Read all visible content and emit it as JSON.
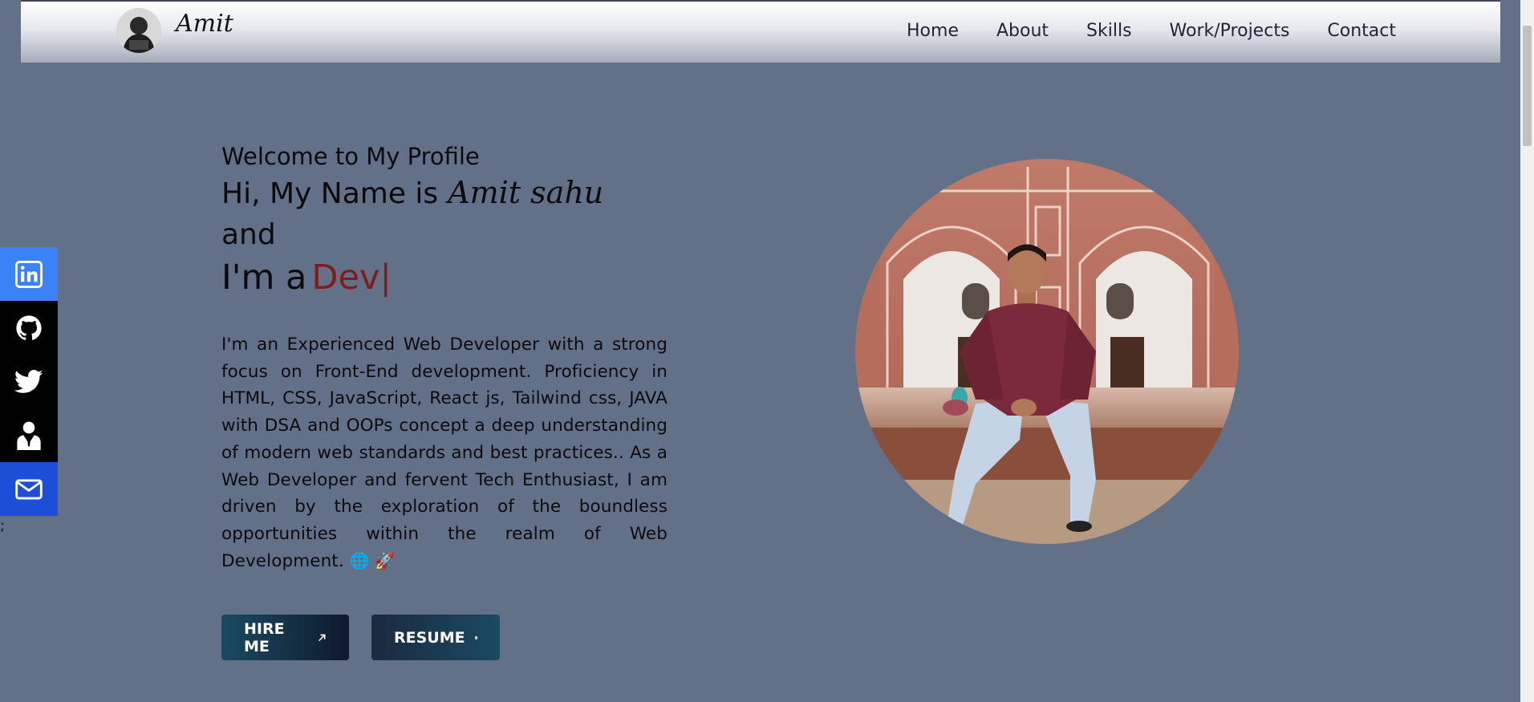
{
  "header": {
    "brand_name": "Amit",
    "nav": [
      "Home",
      "About",
      "Skills",
      "Work/Projects",
      "Contact"
    ]
  },
  "social": {
    "items": [
      {
        "name": "linkedin-icon",
        "color": "#3b82f6"
      },
      {
        "name": "github-icon",
        "color": "#000000"
      },
      {
        "name": "twitter-icon",
        "color": "#000000"
      },
      {
        "name": "user-tie-icon",
        "color": "#000000"
      },
      {
        "name": "mail-icon",
        "color": "#1d4ed8"
      }
    ],
    "stray_text": ";"
  },
  "hero": {
    "welcome": "Welcome to My Profile",
    "hi_prefix": "Hi, My Name is",
    "name_script": "Amit sahu",
    "and": "and",
    "im_prefix": "I'm a",
    "role": "Dev",
    "cursor": "|",
    "bio": "I'm an Experienced Web Developer with a strong focus on Front-End development. Proficiency in HTML, CSS, JavaScript, React js, Tailwind css, JAVA with DSA and OOPs concept a deep understanding of modern web standards and best practices.. As a Web Developer and fervent Tech Enthusiast, I am driven by the exploration of the boundless opportunities within the realm of Web Development.",
    "bio_emoji": "🌐 🚀",
    "buttons": {
      "hire": "HIRE ME",
      "resume": "RESUME"
    }
  },
  "colors": {
    "background": "#627088",
    "accent_role": "#7f1d1d",
    "linkedin": "#3b82f6",
    "mail": "#1d4ed8"
  }
}
